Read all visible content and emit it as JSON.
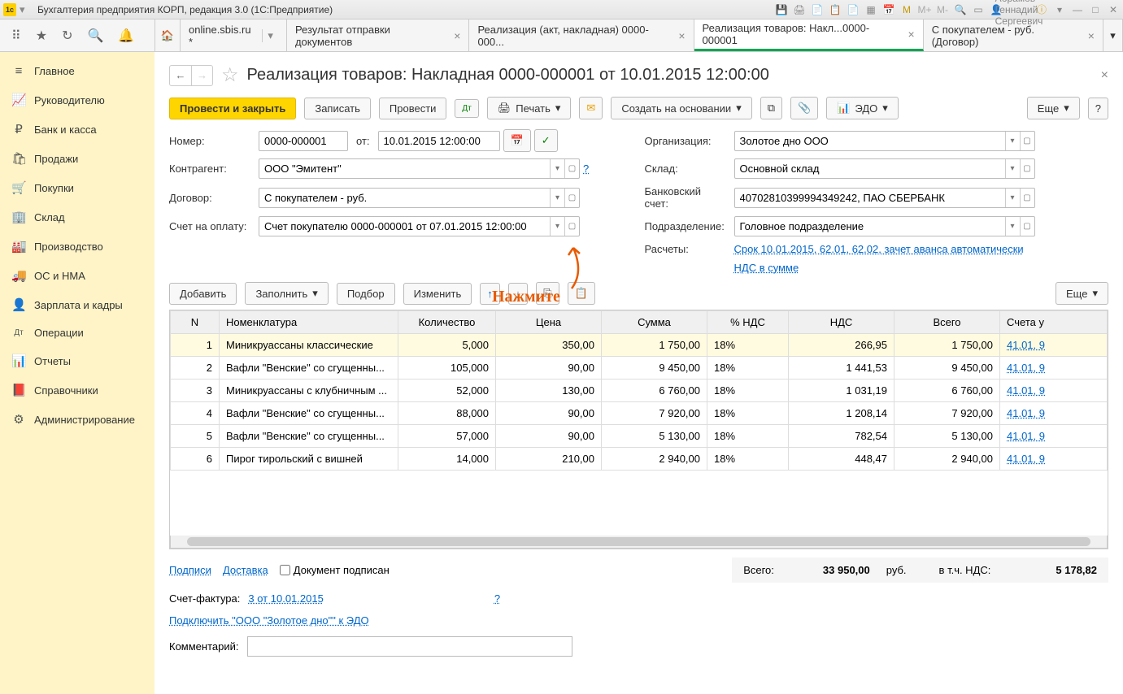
{
  "titlebar": {
    "title": "Бухгалтерия предприятия КОРП, редакция 3.0  (1С:Предприятие)",
    "user": "Абрамов Геннадий Сергеевич",
    "m_icons": [
      "М",
      "М+",
      "М-"
    ]
  },
  "tabs": [
    {
      "label": "online.sbis.ru *"
    },
    {
      "label": "Результат отправки документов"
    },
    {
      "label": "Реализация (акт, накладная) 0000-000..."
    },
    {
      "label": "Реализация товаров: Накл...0000-000001",
      "active": true
    },
    {
      "label": "С покупателем - руб. (Договор)"
    }
  ],
  "sidebar": [
    {
      "icon": "≡",
      "label": "Главное"
    },
    {
      "icon": "📈",
      "label": "Руководителю"
    },
    {
      "icon": "₽",
      "label": "Банк и касса"
    },
    {
      "icon": "🛍",
      "label": "Продажи"
    },
    {
      "icon": "🛒",
      "label": "Покупки"
    },
    {
      "icon": "🏢",
      "label": "Склад"
    },
    {
      "icon": "🏭",
      "label": "Производство"
    },
    {
      "icon": "🚚",
      "label": "ОС и НМА"
    },
    {
      "icon": "👤",
      "label": "Зарплата и кадры"
    },
    {
      "icon": "Дт",
      "label": "Операции"
    },
    {
      "icon": "📊",
      "label": "Отчеты"
    },
    {
      "icon": "📕",
      "label": "Справочники"
    },
    {
      "icon": "⚙",
      "label": "Администрирование"
    }
  ],
  "page": {
    "title": "Реализация товаров: Накладная 0000-000001 от 10.01.2015 12:00:00",
    "close": "×"
  },
  "actions": {
    "post_close": "Провести и закрыть",
    "write": "Записать",
    "post": "Провести",
    "print": "Печать",
    "create_based": "Создать на основании",
    "edo": "ЭДО",
    "more": "Еще",
    "help": "?"
  },
  "form": {
    "number_lbl": "Номер:",
    "number": "0000-000001",
    "from_lbl": "от:",
    "date": "10.01.2015 12:00:00",
    "org_lbl": "Организация:",
    "org": "Золотое дно ООО",
    "counterparty_lbl": "Контрагент:",
    "counterparty": "ООО \"Эмитент\"",
    "warehouse_lbl": "Склад:",
    "warehouse": "Основной склад",
    "contract_lbl": "Договор:",
    "contract": "С покупателем - руб.",
    "bank_lbl": "Банковский счет:",
    "bank": "40702810399994349242, ПАО СБЕРБАНК",
    "invoice_lbl": "Счет на оплату:",
    "invoice": "Счет покупателю 0000-000001 от 07.01.2015 12:00:00",
    "division_lbl": "Подразделение:",
    "division": "Головное подразделение",
    "calc_lbl": "Расчеты:",
    "calc_link": "Срок 10.01.2015, 62.01, 62.02, зачет аванса автоматически",
    "vat_link": "НДС в сумме",
    "help_q": "?"
  },
  "annotation": "Нажмите",
  "table_actions": {
    "add": "Добавить",
    "fill": "Заполнить",
    "pick": "Подбор",
    "change": "Изменить",
    "more": "Еще"
  },
  "table": {
    "headers": [
      "N",
      "Номенклатура",
      "Количество",
      "Цена",
      "Сумма",
      "% НДС",
      "НДС",
      "Всего",
      "Счета у"
    ],
    "rows": [
      {
        "n": 1,
        "name": "Миникруассаны классические",
        "qty": "5,000",
        "price": "350,00",
        "sum": "1 750,00",
        "vat_rate": "18%",
        "vat": "266,95",
        "total": "1 750,00",
        "acc": "41.01, 9"
      },
      {
        "n": 2,
        "name": "Вафли \"Венские\" со сгущенны...",
        "qty": "105,000",
        "price": "90,00",
        "sum": "9 450,00",
        "vat_rate": "18%",
        "vat": "1 441,53",
        "total": "9 450,00",
        "acc": "41.01, 9"
      },
      {
        "n": 3,
        "name": "Миникруассаны с клубничным ...",
        "qty": "52,000",
        "price": "130,00",
        "sum": "6 760,00",
        "vat_rate": "18%",
        "vat": "1 031,19",
        "total": "6 760,00",
        "acc": "41.01, 9"
      },
      {
        "n": 4,
        "name": "Вафли \"Венские\" со сгущенны...",
        "qty": "88,000",
        "price": "90,00",
        "sum": "7 920,00",
        "vat_rate": "18%",
        "vat": "1 208,14",
        "total": "7 920,00",
        "acc": "41.01, 9"
      },
      {
        "n": 5,
        "name": "Вафли \"Венские\" со сгущенны...",
        "qty": "57,000",
        "price": "90,00",
        "sum": "5 130,00",
        "vat_rate": "18%",
        "vat": "782,54",
        "total": "5 130,00",
        "acc": "41.01, 9"
      },
      {
        "n": 6,
        "name": "Пирог тирольский с вишней",
        "qty": "14,000",
        "price": "210,00",
        "sum": "2 940,00",
        "vat_rate": "18%",
        "vat": "448,47",
        "total": "2 940,00",
        "acc": "41.01, 9"
      }
    ]
  },
  "footer": {
    "signatures": "Подписи",
    "delivery": "Доставка",
    "doc_signed": "Документ подписан",
    "total_lbl": "Всего:",
    "total": "33 950,00",
    "currency": "руб.",
    "vat_lbl": "в т.ч. НДС:",
    "vat": "5 178,82"
  },
  "sf": {
    "label": "Счет-фактура:",
    "link": "3 от 10.01.2015",
    "help": "?"
  },
  "edo": {
    "link": "Подключить \"ООО \"Золотое дно\"\" к ЭДО"
  },
  "comment": {
    "label": "Комментарий:",
    "value": ""
  }
}
